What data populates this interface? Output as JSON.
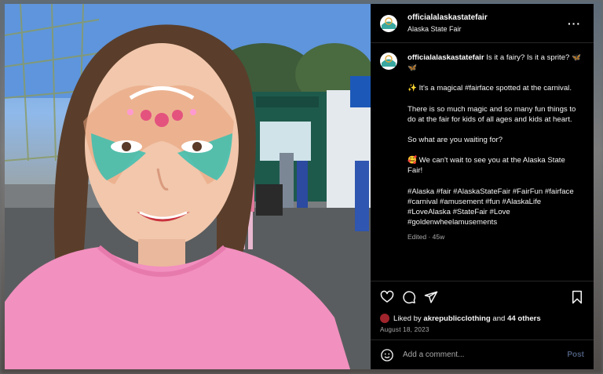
{
  "post": {
    "username": "officialalaskastatefair",
    "location": "Alaska State Fair",
    "caption": {
      "intro": "Is it a fairy? Is it a sprite? 🦋🦋",
      "line1_emoji": "✨",
      "line1_text": "It's a magical",
      "line1_tag": "#fairface",
      "line1_rest": "spotted at the carnival.",
      "line2": "There is so much magic and so many fun things to do at the fair for kids of all ages and kids at heart.",
      "line3": "So what are you waiting for?",
      "line4": "🥰 We can't wait to see you at the Alaska State Fair!",
      "hashtags": "#Alaska #fair #AlaskaStateFair #FairFun #fairface #carnival #amusement #fun #AlaskaLife #LoveAlaska #StateFair #Love #goldenwheelamusements"
    },
    "edited": "Edited · 45w",
    "likes": {
      "prefix": "Liked by",
      "user": "akrepublicclothing",
      "middle": "and",
      "others": "44 others"
    },
    "date": "August 18, 2023"
  },
  "comment_box": {
    "placeholder": "Add a comment...",
    "post_label": "Post"
  },
  "icons": {
    "more": "more-horizontal-icon",
    "like": "heart-icon",
    "comment": "comment-icon",
    "share": "paper-plane-icon",
    "save": "bookmark-icon",
    "emoji": "emoji-icon"
  },
  "colors": {
    "panel_bg": "#000000",
    "text": "#f5f5f5",
    "muted": "#a8a8a8",
    "post_button": "#4a5a78",
    "divider": "#262626"
  }
}
